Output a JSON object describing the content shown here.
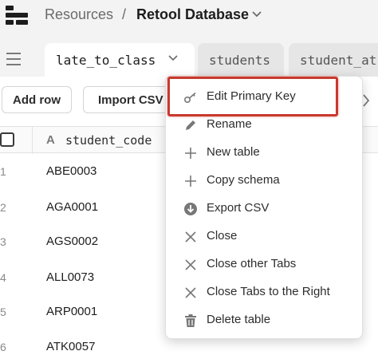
{
  "header": {
    "breadcrumb_root": "Resources",
    "breadcrumb_sep": "/",
    "breadcrumb_db": "Retool Database"
  },
  "tabs": [
    {
      "label": "late_to_class"
    },
    {
      "label": "students"
    },
    {
      "label": "student_at"
    }
  ],
  "toolbar": {
    "add_row": "Add row",
    "import_csv": "Import CSV"
  },
  "table": {
    "type_glyph": "A",
    "column_header": "student_code",
    "rows": [
      {
        "num": "1",
        "code": "ABE0003"
      },
      {
        "num": "2",
        "code": "AGA0001"
      },
      {
        "num": "3",
        "code": "AGS0002"
      },
      {
        "num": "4",
        "code": "ALL0073"
      },
      {
        "num": "5",
        "code": "ARP0001"
      },
      {
        "num": "6",
        "code": "ATK0057"
      }
    ]
  },
  "menu": {
    "items": [
      {
        "label": "Edit Primary Key",
        "icon": "key-icon"
      },
      {
        "label": "Rename",
        "icon": "pencil-icon"
      },
      {
        "label": "New table",
        "icon": "plus-icon"
      },
      {
        "label": "Copy schema",
        "icon": "plus-icon"
      },
      {
        "label": "Export CSV",
        "icon": "download-icon"
      },
      {
        "label": "Close",
        "icon": "close-icon"
      },
      {
        "label": "Close other Tabs",
        "icon": "close-icon"
      },
      {
        "label": "Close Tabs to the Right",
        "icon": "close-icon"
      },
      {
        "label": "Delete table",
        "icon": "trash-icon"
      }
    ]
  },
  "colors": {
    "highlight": "#c9392e",
    "background": "#f3f3f3",
    "panel": "#ffffff"
  }
}
